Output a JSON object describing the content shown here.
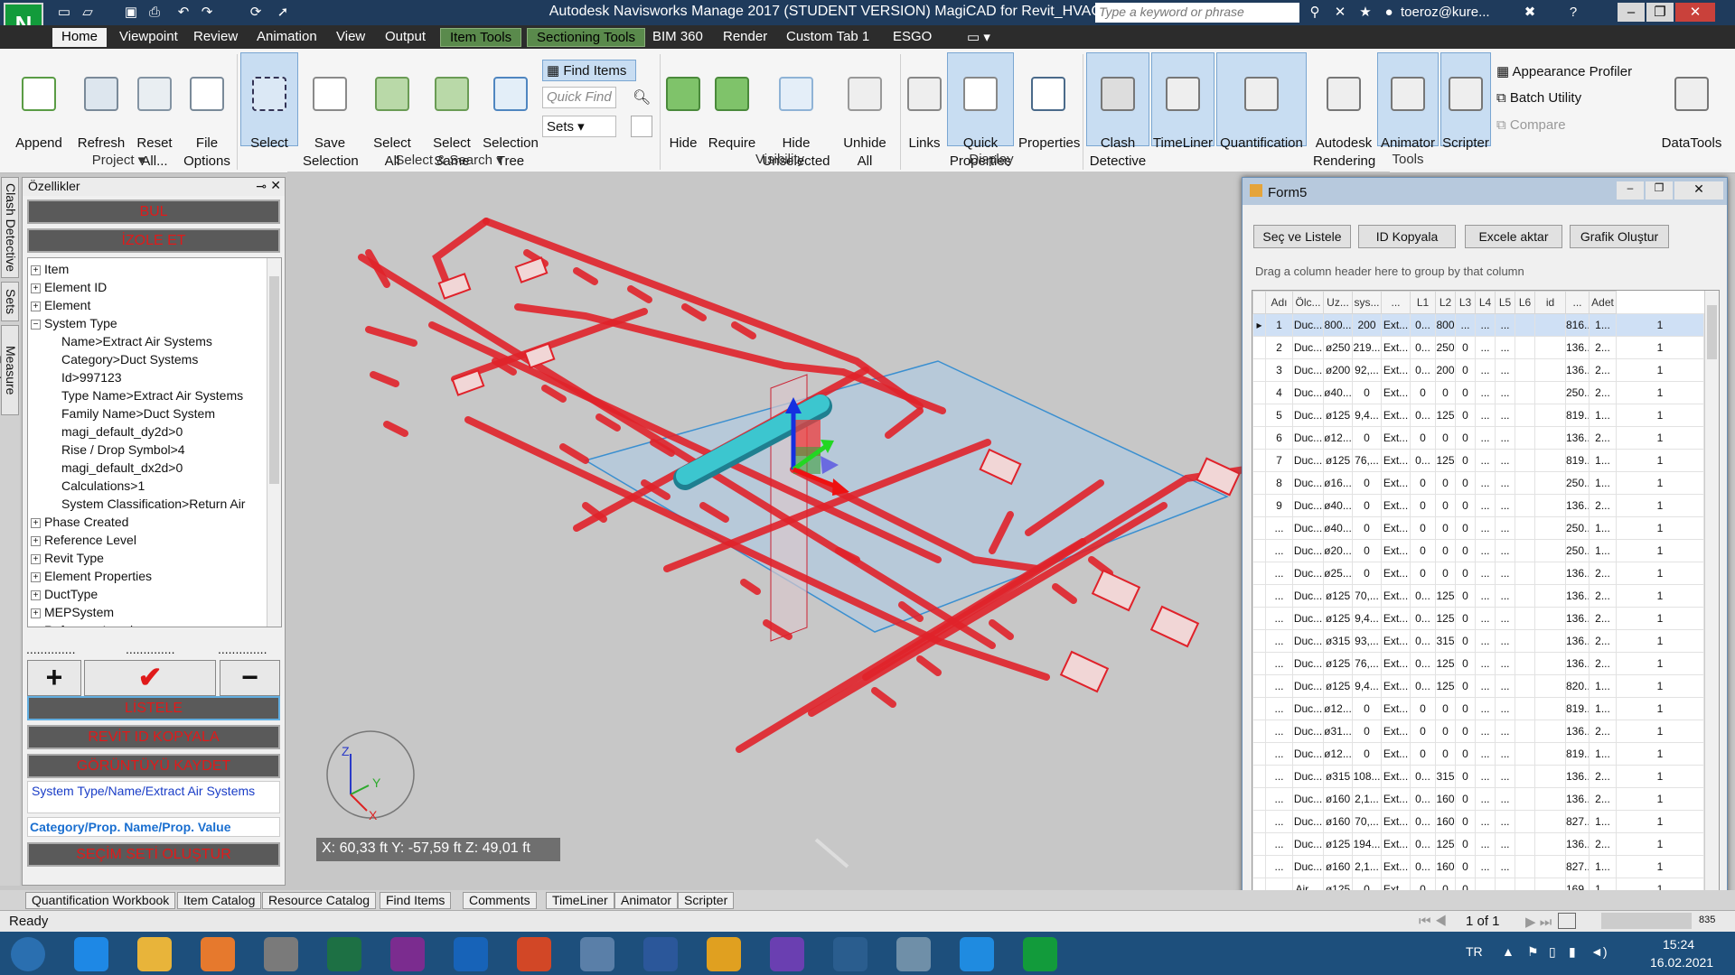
{
  "window": {
    "title": "Autodesk Navisworks Manage 2017 (STUDENT VERSION)    MagiCAD for Revit_HVAC_E-test1.nwd",
    "search_placeholder": "Type a keyword or phrase",
    "user": "toeroz@kure...",
    "app_logo": "N"
  },
  "menu": {
    "items": [
      "Home",
      "Viewpoint",
      "Review",
      "Animation",
      "View",
      "Output",
      "Item Tools",
      "Sectioning Tools",
      "BIM 360",
      "Render",
      "Custom Tab 1",
      "ESGO"
    ],
    "active": "Home"
  },
  "ribbon": {
    "append": "Append",
    "refresh": "Refresh",
    "reset_all": "Reset\nAll...",
    "file_options": "File\nOptions",
    "select": "Select",
    "save_selection": "Save\nSelection",
    "select_all": "Select\nAll",
    "select_same": "Select\nSame",
    "selection_tree": "Selection\nTree",
    "find_items": "Find Items",
    "quick_find_placeholder": "Quick Find",
    "sets": "Sets",
    "hide": "Hide",
    "require": "Require",
    "hide_unselected": "Hide\nUnselected",
    "unhide_all": "Unhide\nAll",
    "links": "Links",
    "quick_properties": "Quick\nProperties",
    "properties": "Properties",
    "clash_detective": "Clash\nDetective",
    "timeliner": "TimeLiner",
    "quantification": "Quantification",
    "autodesk_rendering": "Autodesk\nRendering",
    "animator": "Animator",
    "scripter": "Scripter",
    "appearance_profiler": "Appearance Profiler",
    "batch_utility": "Batch Utility",
    "compare": "Compare",
    "datatools": "DataTools",
    "panels": {
      "project": "Project",
      "select_search": "Select & Search",
      "visibility": "Visibility",
      "display": "Display",
      "tools": "Tools"
    }
  },
  "left_tabs": [
    "Clash Detective",
    "Sets",
    "Measure Tools"
  ],
  "properties_panel": {
    "title": "Özellikler",
    "bul": "BUL",
    "izole_et": "İZOLE ET",
    "tree": [
      {
        "text": "Item",
        "level": 0,
        "exp": "+"
      },
      {
        "text": "Element ID",
        "level": 0,
        "exp": "+"
      },
      {
        "text": "Element",
        "level": 0,
        "exp": "+"
      },
      {
        "text": "System Type",
        "level": 0,
        "exp": "−"
      },
      {
        "text": "Name>Extract Air Systems",
        "level": 1,
        "exp": ""
      },
      {
        "text": "Category>Duct Systems",
        "level": 1,
        "exp": ""
      },
      {
        "text": "Id>997123",
        "level": 1,
        "exp": ""
      },
      {
        "text": "Type Name>Extract Air Systems",
        "level": 1,
        "exp": ""
      },
      {
        "text": "Family Name>Duct System",
        "level": 1,
        "exp": ""
      },
      {
        "text": "magi_default_dy2d>0",
        "level": 1,
        "exp": ""
      },
      {
        "text": "Rise / Drop Symbol>4",
        "level": 1,
        "exp": ""
      },
      {
        "text": "magi_default_dx2d>0",
        "level": 1,
        "exp": ""
      },
      {
        "text": "Calculations>1",
        "level": 1,
        "exp": ""
      },
      {
        "text": "System Classification>Return Air",
        "level": 1,
        "exp": ""
      },
      {
        "text": "Phase Created",
        "level": 0,
        "exp": "+"
      },
      {
        "text": "Reference Level",
        "level": 0,
        "exp": "+"
      },
      {
        "text": "Revit Type",
        "level": 0,
        "exp": "+"
      },
      {
        "text": "Element Properties",
        "level": 0,
        "exp": "+"
      },
      {
        "text": "DuctType",
        "level": 0,
        "exp": "+"
      },
      {
        "text": "MEPSystem",
        "level": 0,
        "exp": "+"
      },
      {
        "text": "ReferenceLevel",
        "level": 0,
        "exp": "+"
      }
    ],
    "dots": "..............",
    "plus": "+",
    "check": "✔",
    "minus": "−",
    "listele": "LİSTELE",
    "revit_id_kopyala": "REVİT ID  KOPYALA",
    "goruntuyu_kaydet": "GÖRÜNTÜYÜ KAYDET",
    "system_path": "System Type/Name/Extract Air Systems",
    "prop_path": "Category/Prop. Name/Prop. Value",
    "secim_seti": "SEÇİM SETİ OLUŞTUR"
  },
  "viewport": {
    "coords": "X: 60,33 ft   Y: -57,59 ft   Z: 49,01 ft",
    "axis_x": "X",
    "axis_y": "Y",
    "axis_z": "Z"
  },
  "form5": {
    "title": "Form5",
    "buttons": [
      "Seç ve  Listele",
      "ID Kopyala",
      "Excele aktar",
      "Grafik Oluştur"
    ],
    "drag_hint": "Drag a column header here to group by that column",
    "columns": [
      "",
      "Adı",
      "Ölc...",
      "Uz...",
      "sys...",
      "...",
      "L1",
      "L2",
      "L3",
      "L4",
      "L5",
      "L6",
      "id",
      "...",
      "Adet"
    ],
    "rows": [
      [
        "1",
        "Duc...",
        "800...",
        "200",
        "Ext...",
        "0...",
        "800",
        "...",
        "...",
        "...",
        "",
        "",
        "816...",
        "1...",
        "1"
      ],
      [
        "2",
        "Duc...",
        "ø250",
        "219...",
        "Ext...",
        "0...",
        "250",
        "0",
        "...",
        "...",
        "",
        "",
        "136...",
        "2...",
        "1"
      ],
      [
        "3",
        "Duc...",
        "ø200",
        "92,...",
        "Ext...",
        "0...",
        "200",
        "0",
        "...",
        "...",
        "",
        "",
        "136...",
        "2...",
        "1"
      ],
      [
        "4",
        "Duc...",
        "ø40...",
        "0",
        "Ext...",
        "0",
        "0",
        "0",
        "...",
        "...",
        "",
        "",
        "250...",
        "2...",
        "1"
      ],
      [
        "5",
        "Duc...",
        "ø125",
        "9,4...",
        "Ext...",
        "0...",
        "125",
        "0",
        "...",
        "...",
        "",
        "",
        "819...",
        "1...",
        "1"
      ],
      [
        "6",
        "Duc...",
        "ø12...",
        "0",
        "Ext...",
        "0",
        "0",
        "0",
        "...",
        "...",
        "",
        "",
        "136...",
        "2...",
        "1"
      ],
      [
        "7",
        "Duc...",
        "ø125",
        "76,...",
        "Ext...",
        "0...",
        "125",
        "0",
        "...",
        "...",
        "",
        "",
        "819...",
        "1...",
        "1"
      ],
      [
        "8",
        "Duc...",
        "ø16...",
        "0",
        "Ext...",
        "0",
        "0",
        "0",
        "...",
        "...",
        "",
        "",
        "250...",
        "1...",
        "1"
      ],
      [
        "9",
        "Duc...",
        "ø40...",
        "0",
        "Ext...",
        "0",
        "0",
        "0",
        "...",
        "...",
        "",
        "",
        "136...",
        "2...",
        "1"
      ],
      [
        "...",
        "Duc...",
        "ø40...",
        "0",
        "Ext...",
        "0",
        "0",
        "0",
        "...",
        "...",
        "",
        "",
        "250...",
        "1...",
        "1"
      ],
      [
        "...",
        "Duc...",
        "ø20...",
        "0",
        "Ext...",
        "0",
        "0",
        "0",
        "...",
        "...",
        "",
        "",
        "250...",
        "1...",
        "1"
      ],
      [
        "...",
        "Duc...",
        "ø25...",
        "0",
        "Ext...",
        "0",
        "0",
        "0",
        "...",
        "...",
        "",
        "",
        "136...",
        "2...",
        "1"
      ],
      [
        "...",
        "Duc...",
        "ø125",
        "70,...",
        "Ext...",
        "0...",
        "125",
        "0",
        "...",
        "...",
        "",
        "",
        "136...",
        "2...",
        "1"
      ],
      [
        "...",
        "Duc...",
        "ø125",
        "9,4...",
        "Ext...",
        "0...",
        "125",
        "0",
        "...",
        "...",
        "",
        "",
        "136...",
        "2...",
        "1"
      ],
      [
        "...",
        "Duc...",
        "ø315",
        "93,...",
        "Ext...",
        "0...",
        "315",
        "0",
        "...",
        "...",
        "",
        "",
        "136...",
        "2...",
        "1"
      ],
      [
        "...",
        "Duc...",
        "ø125",
        "76,...",
        "Ext...",
        "0...",
        "125",
        "0",
        "...",
        "...",
        "",
        "",
        "136...",
        "2...",
        "1"
      ],
      [
        "...",
        "Duc...",
        "ø125",
        "9,4...",
        "Ext...",
        "0...",
        "125",
        "0",
        "...",
        "...",
        "",
        "",
        "820...",
        "1...",
        "1"
      ],
      [
        "...",
        "Duc...",
        "ø12...",
        "0",
        "Ext...",
        "0",
        "0",
        "0",
        "...",
        "...",
        "",
        "",
        "819...",
        "1...",
        "1"
      ],
      [
        "...",
        "Duc...",
        "ø31...",
        "0",
        "Ext...",
        "0",
        "0",
        "0",
        "...",
        "...",
        "",
        "",
        "136...",
        "2...",
        "1"
      ],
      [
        "...",
        "Duc...",
        "ø12...",
        "0",
        "Ext...",
        "0",
        "0",
        "0",
        "...",
        "...",
        "",
        "",
        "819...",
        "1...",
        "1"
      ],
      [
        "...",
        "Duc...",
        "ø315",
        "108...",
        "Ext...",
        "0...",
        "315",
        "0",
        "...",
        "...",
        "",
        "",
        "136...",
        "2...",
        "1"
      ],
      [
        "...",
        "Duc...",
        "ø160",
        "2,1...",
        "Ext...",
        "0...",
        "160",
        "0",
        "...",
        "...",
        "",
        "",
        "136...",
        "2...",
        "1"
      ],
      [
        "...",
        "Duc...",
        "ø160",
        "70,...",
        "Ext...",
        "0...",
        "160",
        "0",
        "...",
        "...",
        "",
        "",
        "827...",
        "1...",
        "1"
      ],
      [
        "...",
        "Duc...",
        "ø125",
        "194...",
        "Ext...",
        "0...",
        "125",
        "0",
        "...",
        "...",
        "",
        "",
        "136...",
        "2...",
        "1"
      ],
      [
        "...",
        "Duc...",
        "ø160",
        "2,1...",
        "Ext...",
        "0...",
        "160",
        "0",
        "...",
        "...",
        "",
        "",
        "827...",
        "1...",
        "1"
      ],
      [
        "...",
        "Air ...",
        "ø125",
        "0",
        "Ext...",
        "0",
        "0",
        "0",
        "...",
        "...",
        "",
        "",
        "169...",
        "1...",
        "1"
      ]
    ]
  },
  "bottom_tabs": [
    "Quantification Workbook",
    "Item Catalog",
    "Resource Catalog",
    "Find Items",
    "Comments",
    "TimeLiner",
    "Animator",
    "Scripter"
  ],
  "status": {
    "left": "Ready",
    "page": "1 of 1",
    "mem": "835"
  },
  "taskbar": {
    "lang": "TR",
    "time": "15:24",
    "date": "16.02.2021",
    "apps": [
      "start-icon",
      "ie-icon",
      "explorer-icon",
      "media-icon",
      "snipping-icon",
      "excel-icon",
      "onenote-icon",
      "outlook-icon",
      "powerpoint-icon",
      "paint-icon",
      "word-icon",
      "chrome-icon",
      "visual-studio-icon",
      "navisworks-viewer-icon",
      "notepad-icon",
      "edge-icon",
      "navisworks-icon"
    ]
  },
  "colors": {
    "duct": "#e0222a",
    "selected_duct": "#3cc6cf",
    "section_plane": "#9fc5e8",
    "ribbon_bg": "#f5f5f5",
    "title_bg": "#1f3b5c"
  }
}
